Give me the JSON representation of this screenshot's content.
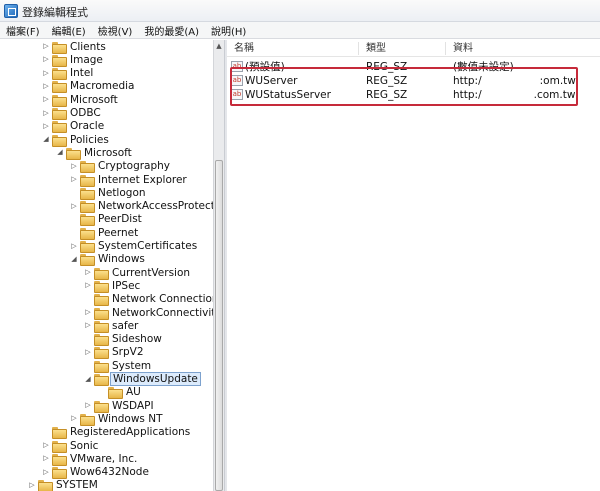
{
  "window": {
    "title": "登錄編輯程式"
  },
  "menu": [
    "檔案(F)",
    "編輯(E)",
    "檢視(V)",
    "我的最愛(A)",
    "說明(H)"
  ],
  "tree": [
    {
      "label": "Clients",
      "depth": 1,
      "expander": "collapsed"
    },
    {
      "label": "Image",
      "depth": 1,
      "expander": "collapsed"
    },
    {
      "label": "Intel",
      "depth": 1,
      "expander": "collapsed"
    },
    {
      "label": "Macromedia",
      "depth": 1,
      "expander": "collapsed"
    },
    {
      "label": "Microsoft",
      "depth": 1,
      "expander": "collapsed"
    },
    {
      "label": "ODBC",
      "depth": 1,
      "expander": "collapsed"
    },
    {
      "label": "Oracle",
      "depth": 1,
      "expander": "collapsed"
    },
    {
      "label": "Policies",
      "depth": 1,
      "expander": "expanded"
    },
    {
      "label": "Microsoft",
      "depth": 2,
      "expander": "expanded"
    },
    {
      "label": "Cryptography",
      "depth": 3,
      "expander": "collapsed"
    },
    {
      "label": "Internet Explorer",
      "depth": 3,
      "expander": "collapsed"
    },
    {
      "label": "Netlogon",
      "depth": 3,
      "expander": "none"
    },
    {
      "label": "NetworkAccessProtection",
      "depth": 3,
      "expander": "collapsed"
    },
    {
      "label": "PeerDist",
      "depth": 3,
      "expander": "none"
    },
    {
      "label": "Peernet",
      "depth": 3,
      "expander": "none"
    },
    {
      "label": "SystemCertificates",
      "depth": 3,
      "expander": "collapsed"
    },
    {
      "label": "Windows",
      "depth": 3,
      "expander": "expanded"
    },
    {
      "label": "CurrentVersion",
      "depth": 4,
      "expander": "collapsed"
    },
    {
      "label": "IPSec",
      "depth": 4,
      "expander": "collapsed"
    },
    {
      "label": "Network Connections",
      "depth": 4,
      "expander": "none"
    },
    {
      "label": "NetworkConnectivityStat",
      "depth": 4,
      "expander": "collapsed"
    },
    {
      "label": "safer",
      "depth": 4,
      "expander": "collapsed"
    },
    {
      "label": "Sideshow",
      "depth": 4,
      "expander": "none"
    },
    {
      "label": "SrpV2",
      "depth": 4,
      "expander": "collapsed"
    },
    {
      "label": "System",
      "depth": 4,
      "expander": "none"
    },
    {
      "label": "WindowsUpdate",
      "depth": 4,
      "expander": "expanded",
      "selected": true
    },
    {
      "label": "AU",
      "depth": 5,
      "expander": "none"
    },
    {
      "label": "WSDAPI",
      "depth": 4,
      "expander": "collapsed"
    },
    {
      "label": "Windows NT",
      "depth": 3,
      "expander": "collapsed"
    },
    {
      "label": "RegisteredApplications",
      "depth": 1,
      "expander": "none"
    },
    {
      "label": "Sonic",
      "depth": 1,
      "expander": "collapsed"
    },
    {
      "label": "VMware, Inc.",
      "depth": 1,
      "expander": "collapsed"
    },
    {
      "label": "Wow6432Node",
      "depth": 1,
      "expander": "collapsed"
    },
    {
      "label": "SYSTEM",
      "depth": 0,
      "expander": "collapsed"
    }
  ],
  "list": {
    "columns": [
      "名稱",
      "類型",
      "資料"
    ],
    "rows": [
      {
        "name": "(預設值)",
        "type": "REG_SZ",
        "data_prefix": "(數值未設定)",
        "data_suffix": ""
      },
      {
        "name": "WUServer",
        "type": "REG_SZ",
        "data_prefix": "http:/",
        "data_suffix": ":om.tw"
      },
      {
        "name": "WUStatusServer",
        "type": "REG_SZ",
        "data_prefix": "http:/",
        "data_suffix": ".com.tw"
      }
    ]
  },
  "icons": {
    "app": "registry-editor-icon",
    "folder": "folder-icon",
    "string_value": "string-value-icon",
    "ab_text": "ab"
  },
  "colors": {
    "highlight": "#c62a3a",
    "selection": "#dcebfc"
  }
}
